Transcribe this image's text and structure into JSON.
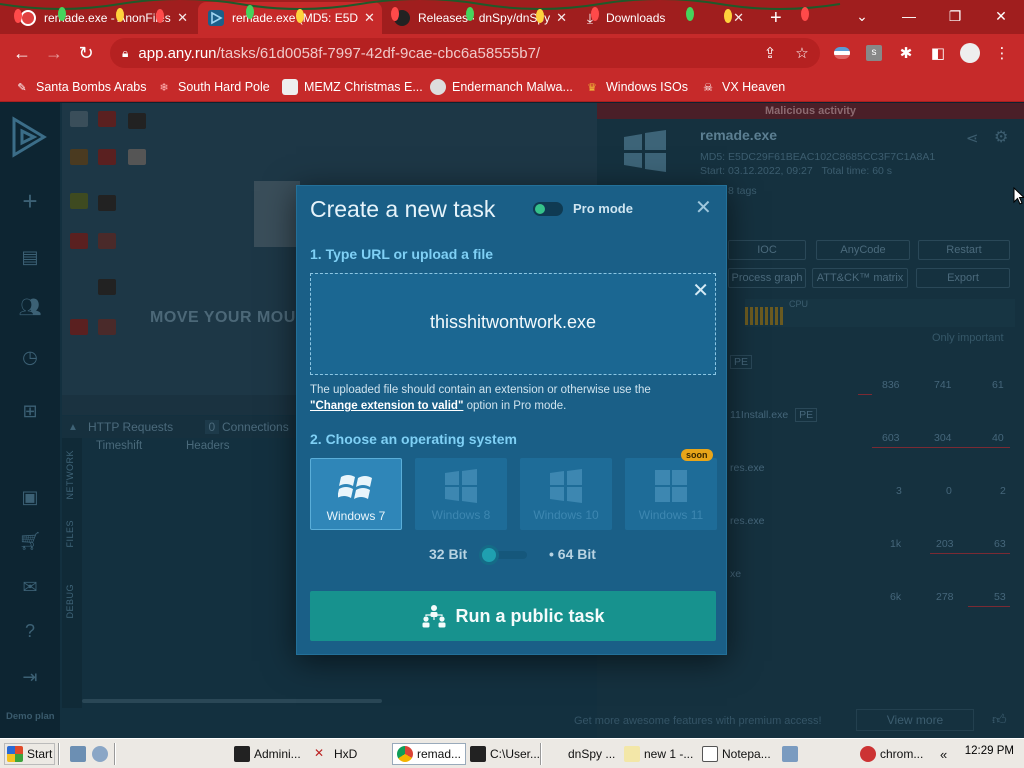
{
  "tabs": [
    {
      "title": "remade.exe - AnonFiles",
      "favicon": "anonfiles-icon"
    },
    {
      "title": "remade.exe (MD5: E5D",
      "favicon": "anyrun-icon"
    },
    {
      "title": "Releases · dnSpy/dnSpy",
      "favicon": "github-icon"
    },
    {
      "title": "Downloads",
      "favicon": "download-icon"
    }
  ],
  "new_tab": "+",
  "address": {
    "host": "app.any.run",
    "path": "/tasks/61d0058f-7997-42df-9cae-cbc6a58555b7/"
  },
  "bookmarks": [
    "Santa Bombs Arabs",
    "South Hard Pole",
    "MEMZ Christmas E...",
    "Endermanch Malwa...",
    "Windows ISOs",
    "VX Heaven"
  ],
  "background": {
    "vm_overlay_text": "MOVE YOUR MOUS",
    "panel_tabs": {
      "http": "HTTP Requests",
      "http_count": "0",
      "connections": "Connections"
    },
    "columns": {
      "timeshift": "Timeshift",
      "headers": "Headers"
    },
    "side_labels": [
      "NETWORK",
      "FILES",
      "DEBUG"
    ],
    "plan": "Demo plan",
    "malicious": "Malicious activity",
    "task_name": "remade.exe",
    "md5": "MD5: E5DC29F61BEAC102C8685CC3F7C1A8A1",
    "start": "Start: 03.12.2022, 09:27",
    "total_time": "Total time: 60 s",
    "tags": "8 tags",
    "buttons": {
      "ioc": "IOC",
      "anycode": "AnyCode",
      "restart": "Restart",
      "process_graph": "Process graph",
      "attck": "ATT&CK™ matrix",
      "export": "Export"
    },
    "only_important": "Only important",
    "cpu": "CPU",
    "processes": [
      {
        "name": "",
        "tag": "PE",
        "counts": [
          "836",
          "741",
          "61"
        ]
      },
      {
        "name": "11Install.exe",
        "tag": "PE",
        "counts": [
          "603",
          "304",
          "40"
        ]
      },
      {
        "name": "res.exe",
        "tag": "",
        "counts": [
          "3",
          "0",
          "2"
        ]
      },
      {
        "name": "res.exe",
        "tag": "",
        "counts": [
          "1k",
          "203",
          "63"
        ]
      },
      {
        "name": "xe",
        "tag": "",
        "counts": [
          "6k",
          "278",
          "53"
        ]
      }
    ],
    "premium": "Get more awesome features with premium access!",
    "view_more": "View more"
  },
  "modal": {
    "title": "Create a new task",
    "pro_mode": "Pro mode",
    "step1": "1. Type URL or upload a file",
    "file_name": "thisshitwontwork.exe",
    "hint_before": "The uploaded file should contain an extension or otherwise use the",
    "hint_link": "\"Change extension to valid\"",
    "hint_after": "option in Pro mode.",
    "step2": "2. Choose an operating system",
    "os": [
      "Windows 7",
      "Windows 8",
      "Windows 10",
      "Windows 11"
    ],
    "soon": "soon",
    "bit32": "32 Bit",
    "bit64": "• 64 Bit",
    "run": "Run a public task"
  },
  "taskbar": {
    "start": "Start",
    "items": [
      "Admini...",
      "HxD",
      "remad...",
      "C:\\User...",
      "dnSpy ...",
      "new 1 -...",
      "Notepa...",
      "chrom..."
    ],
    "clock": "12:29 PM"
  },
  "colors": {
    "chrome_red": "#c62a2a",
    "modal_bg": "#1a5f87",
    "run_button": "#17928e",
    "accent_link": "#7fd0f5"
  }
}
